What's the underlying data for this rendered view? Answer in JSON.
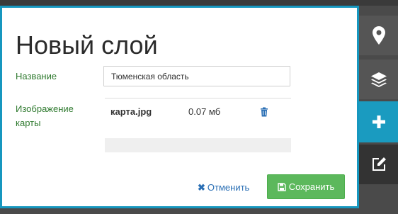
{
  "dialog": {
    "title": "Новый слой",
    "name_label": "Название",
    "name_value": "Тюменская область",
    "image_label": "Изображение карты",
    "files": [
      {
        "name": "карта.jpg",
        "size": "0.07 мб"
      }
    ],
    "cancel_label": "Отменить",
    "save_label": "Сохранить"
  },
  "toolbar": {
    "items": [
      {
        "icon": "map-marker-icon"
      },
      {
        "icon": "layers-icon"
      },
      {
        "icon": "plus-icon",
        "active": true
      },
      {
        "icon": "edit-icon"
      }
    ]
  },
  "colors": {
    "accent": "#1697bf",
    "label_green": "#2f7a2f",
    "save_green": "#5cb85c",
    "link_blue": "#2a6fb5",
    "toolbar_gray": "#555555",
    "toolbar_dark": "#333333"
  }
}
